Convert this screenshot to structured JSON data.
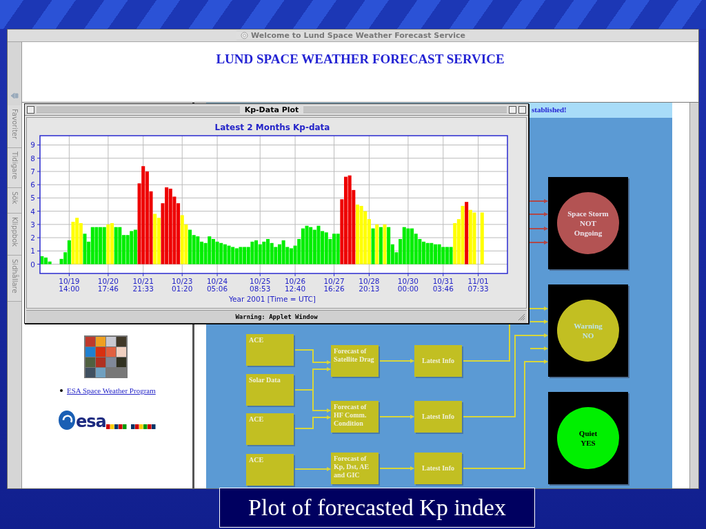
{
  "browser": {
    "title": "Welcome to Lund Space Weather Forecast Service",
    "sidebar_tabs": [
      {
        "label": "Favoriter"
      },
      {
        "label": "Tidigare"
      },
      {
        "label": "Sök"
      },
      {
        "label": "Klippbok"
      },
      {
        "label": "Sidhållare"
      }
    ],
    "banner": {
      "heading": "LUND SPACE WEATHER FORECAST SERVICE"
    },
    "left_frame": {
      "links": [
        "ESA Space Weather Program"
      ],
      "logo_text": "esa"
    },
    "right_frame": {
      "notice": "stablished!",
      "diagram": {
        "sources": [
          "ACE",
          "Solar Data",
          "ACE",
          "ACE"
        ],
        "forecasts": [
          "Forecast of Satellite Drag",
          "Forecast of HF Comm. Condition",
          "Forecast of Kp, Dst, AE and GIC"
        ],
        "outputs": [
          "Latest Info",
          "Latest Info",
          "Latest Info"
        ],
        "indicators": [
          {
            "kind": "storm",
            "lines": [
              "Space Storm",
              "NOT",
              "Ongoing"
            ],
            "color": "#b35353"
          },
          {
            "kind": "warning",
            "lines": [
              "Warning",
              "NO"
            ],
            "color": "#c2bf22"
          },
          {
            "kind": "quiet",
            "lines": [
              "Quiet",
              "YES"
            ],
            "color": "#00f000"
          }
        ]
      }
    }
  },
  "applet": {
    "title": "Kp-Data Plot",
    "status": "Warning: Applet Window",
    "chart_data": {
      "type": "bar",
      "title": "Latest 2 Months Kp-data",
      "xlabel": "Year 2001  [Time = UTC]",
      "categories": [
        null,
        null,
        null,
        null,
        null,
        null,
        null,
        "10/19\n14:00",
        null,
        null,
        null,
        null,
        null,
        null,
        null,
        null,
        null,
        "10/20\n17:46",
        null,
        null,
        null,
        null,
        null,
        null,
        null,
        null,
        "10/21\n21:33",
        null,
        null,
        null,
        null,
        null,
        null,
        null,
        null,
        null,
        "10/23\n01:20",
        null,
        null,
        null,
        null,
        null,
        null,
        null,
        null,
        "10/24\n05:06",
        null,
        null,
        null,
        null,
        null,
        null,
        null,
        null,
        null,
        null,
        "10/25\n08:53",
        null,
        null,
        null,
        null,
        null,
        null,
        null,
        null,
        "10/26\n12:40",
        null,
        null,
        null,
        null,
        null,
        null,
        null,
        null,
        null,
        "10/27\n16:26",
        null,
        null,
        null,
        null,
        null,
        null,
        null,
        null,
        "10/28\n20:13",
        null,
        null,
        null,
        null,
        null,
        null,
        null,
        null,
        null,
        "10/30\n00:00",
        null,
        null,
        null,
        null,
        null,
        null,
        null,
        null,
        "10/31\n03:46",
        null,
        null,
        null,
        null,
        null,
        null,
        null,
        null,
        "11/01\n07:33",
        null,
        null,
        null,
        null,
        null,
        null,
        null
      ],
      "series": [
        {
          "color": "#00ee00",
          "values": [
            0.6,
            0.5,
            0.2,
            null,
            null,
            0.4,
            0.9,
            1.8,
            null,
            null,
            null,
            2.3,
            1.7,
            2.8,
            2.8,
            2.8,
            2.8,
            null,
            null,
            2.8,
            2.8,
            2.2,
            2.2,
            2.5,
            2.6,
            null,
            null,
            null,
            null,
            null,
            null,
            null,
            null,
            null,
            null,
            null,
            null,
            null,
            2.6,
            2.2,
            2.1,
            1.7,
            1.6,
            2.1,
            1.9,
            1.7,
            1.6,
            1.5,
            1.4,
            1.3,
            1.2,
            1.3,
            1.3,
            1.3,
            1.7,
            1.8,
            1.5,
            1.7,
            1.9,
            1.6,
            1.3,
            1.5,
            1.8,
            1.3,
            1.2,
            1.4,
            1.9,
            2.7,
            2.9,
            2.8,
            2.6,
            2.9,
            2.5,
            2.4,
            1.9,
            2.3,
            2.3,
            null,
            null,
            null,
            null,
            null,
            null,
            null,
            null,
            2.7,
            null,
            2.8,
            null,
            2.8,
            1.5,
            0.9,
            1.9,
            2.8,
            2.7,
            2.7,
            2.3,
            1.9,
            1.7,
            1.6,
            1.6,
            1.5,
            1.5,
            1.3,
            1.3,
            1.3,
            null,
            null,
            null,
            null,
            null,
            null,
            null,
            null,
            null,
            null,
            null,
            null,
            null,
            null
          ]
        },
        {
          "color": "#ffff00",
          "values": [
            null,
            null,
            null,
            null,
            null,
            null,
            null,
            null,
            3.2,
            3.5,
            3.1,
            null,
            null,
            null,
            null,
            null,
            null,
            3.0,
            3.1,
            null,
            null,
            null,
            null,
            null,
            null,
            null,
            null,
            null,
            null,
            3.8,
            3.5,
            null,
            null,
            null,
            null,
            null,
            3.7,
            3.0,
            null,
            null,
            null,
            null,
            null,
            null,
            null,
            null,
            null,
            null,
            null,
            null,
            null,
            null,
            null,
            null,
            null,
            null,
            null,
            null,
            null,
            null,
            null,
            null,
            null,
            null,
            null,
            null,
            null,
            null,
            null,
            null,
            null,
            null,
            null,
            null,
            null,
            null,
            null,
            null,
            null,
            null,
            null,
            4.5,
            4.4,
            4.0,
            3.4,
            null,
            3.0,
            null,
            3.0,
            null,
            null,
            null,
            null,
            null,
            null,
            null,
            null,
            null,
            null,
            null,
            null,
            null,
            null,
            null,
            null,
            null,
            3.1,
            3.4,
            4.4,
            null,
            4.1,
            3.9,
            null,
            3.9,
            null,
            null,
            null,
            null,
            null,
            null
          ]
        },
        {
          "color": "#ee0000",
          "values": [
            null,
            null,
            null,
            null,
            null,
            null,
            null,
            null,
            null,
            null,
            null,
            null,
            null,
            null,
            null,
            null,
            null,
            null,
            null,
            null,
            null,
            null,
            null,
            null,
            null,
            6.1,
            7.4,
            7.0,
            5.5,
            null,
            null,
            4.6,
            5.8,
            5.7,
            5.1,
            4.6,
            null,
            null,
            null,
            null,
            null,
            null,
            null,
            null,
            null,
            null,
            null,
            null,
            null,
            null,
            null,
            null,
            null,
            null,
            null,
            null,
            null,
            null,
            null,
            null,
            null,
            null,
            null,
            null,
            null,
            null,
            null,
            null,
            null,
            null,
            null,
            null,
            null,
            null,
            null,
            null,
            null,
            4.9,
            6.6,
            6.7,
            5.6,
            null,
            null,
            null,
            null,
            null,
            null,
            null,
            null,
            null,
            null,
            null,
            null,
            null,
            null,
            null,
            null,
            null,
            null,
            null,
            null,
            null,
            null,
            null,
            null,
            null,
            null,
            null,
            null,
            4.7,
            null,
            null,
            null,
            null,
            null,
            null,
            null,
            null,
            null,
            null
          ]
        }
      ],
      "grid": true,
      "ylim": [
        -0.7,
        9.7
      ],
      "yticks": [
        0,
        1,
        2,
        3,
        4,
        5,
        6,
        7,
        8,
        9
      ]
    }
  },
  "caption": "Plot of forecasted Kp index"
}
